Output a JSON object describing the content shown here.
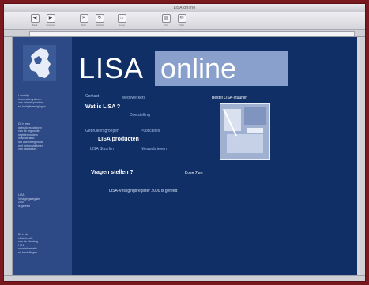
{
  "window": {
    "title": "LISA online"
  },
  "toolbar": {
    "buttons": [
      {
        "label": "Back",
        "icon": "back-arrow-icon"
      },
      {
        "label": "Forward",
        "icon": "forward-arrow-icon"
      },
      {
        "label": "Stop",
        "icon": "stop-icon"
      },
      {
        "label": "Refresh",
        "icon": "refresh-icon"
      },
      {
        "label": "Home",
        "icon": "home-icon"
      },
      {
        "label": "Print",
        "icon": "print-icon"
      },
      {
        "label": "Mail",
        "icon": "mail-icon"
      }
    ]
  },
  "address": {
    "value": ""
  },
  "page": {
    "header": {
      "left": "LISA",
      "right": "online"
    },
    "nav": {
      "row1": [
        "Contact",
        "Medewerkers"
      ],
      "what_is_lisa": "Wat is LISA ?",
      "row2": [
        "Doelstelling"
      ],
      "row3": [
        "Gebruikersgroepen",
        "Publicaties"
      ],
      "lisa_producten": "LISA producten",
      "row4": [
        "LISA Stuurlijn",
        "Nieuwsbrieven"
      ],
      "vragen": "Vragen stellen ?",
      "news": "LISA-Vestigingsregister 2000 is gereed"
    },
    "right_panel": {
      "label_top": "Bestel LISA-stuurlijn",
      "label_bottom": "Even Zien"
    },
    "sidebar": {
      "block1": [
        "Landelijk",
        "Informatiesysteem",
        "van Arbeidsplaatsen",
        "en bedrijfsvestigingen"
      ],
      "block2": [
        "Dit is een",
        "gebruikersplatform",
        "van de regionale",
        "registerhouders",
        "in Nederland",
        "dat zich bezighoudt",
        "met het ontwikkelen",
        "van databases"
      ],
      "block3": [
        "LISA-",
        "Vestigingsregister",
        "2000",
        "is gereed"
      ],
      "block4": [
        "Dit is de",
        "officiele site",
        "van de stichting",
        "LISA",
        "voor informatie",
        "en bestellingen"
      ]
    }
  },
  "status": {
    "text": ""
  },
  "colors": {
    "page_bg": "#0f2f66",
    "sidebar_bg": "#2d4a86",
    "online_bg": "#8aa0cc",
    "frame": "#7a1820"
  }
}
